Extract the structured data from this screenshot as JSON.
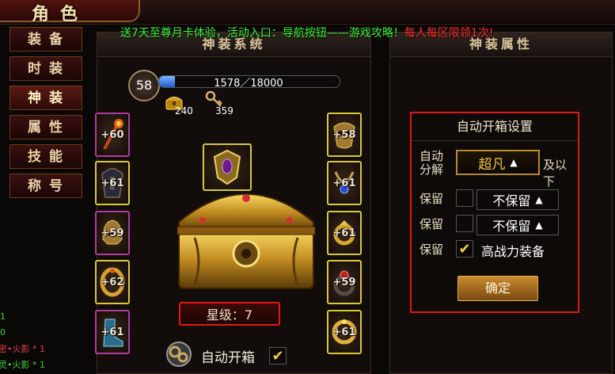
{
  "window": {
    "title": "角色"
  },
  "announcement": {
    "green": "送7天至尊月卡体验，活动入口：导航按钮——游戏攻略！",
    "red": "每人每区限领1次!"
  },
  "menu": [
    {
      "label": "装备",
      "active": false
    },
    {
      "label": "时装",
      "active": false
    },
    {
      "label": "神装",
      "active": true
    },
    {
      "label": "属性",
      "active": false
    },
    {
      "label": "技能",
      "active": false
    },
    {
      "label": "称号",
      "active": false
    }
  ],
  "left_panel": {
    "title": "神装系统",
    "level": "58",
    "xp_text": "1578／18000",
    "xp_fraction": 0.088,
    "resources": [
      {
        "icon": "gold-chest-icon",
        "count": "240"
      },
      {
        "icon": "key-icon",
        "count": "359"
      }
    ],
    "left_slots": [
      {
        "plus": "+60",
        "border": "purple",
        "icon": "flame-staff-icon"
      },
      {
        "plus": "+61",
        "border": "yellow",
        "icon": "dark-armor-icon"
      },
      {
        "plus": "+59",
        "border": "purple",
        "icon": "gold-helm-icon"
      },
      {
        "plus": "+62",
        "border": "yellow",
        "icon": "gold-bracer-icon"
      },
      {
        "plus": "+61",
        "border": "purple",
        "icon": "crystal-boots-icon"
      }
    ],
    "right_slots": [
      {
        "plus": "+58",
        "border": "yellow",
        "icon": "gold-mask-icon"
      },
      {
        "plus": "+61",
        "border": "yellow",
        "icon": "sapphire-necklace-icon"
      },
      {
        "plus": "+61",
        "border": "yellow",
        "icon": "gold-ring-icon"
      },
      {
        "plus": "+59",
        "border": "yellow",
        "icon": "ruby-ring-icon"
      },
      {
        "plus": "+61",
        "border": "yellow",
        "icon": "gold-bangle-icon"
      }
    ],
    "center_slot": {
      "icon": "ornate-shield-icon",
      "border": "yellow"
    },
    "star_level": "星级：7",
    "auto_open_label": "自动开箱",
    "auto_open_checked": true
  },
  "right_panel": {
    "title": "神装属性",
    "dialog": {
      "title": "自动开箱设置",
      "decompose_label": "自动分解",
      "decompose_value": "超凡",
      "decompose_suffix": "及以下",
      "rows": [
        {
          "label": "保留",
          "checked": false,
          "value": "不保留"
        },
        {
          "label": "保留",
          "checked": false,
          "value": "不保留"
        },
        {
          "label": "保留",
          "checked": true,
          "value": "高战力装备"
        }
      ],
      "confirm": "确定"
    }
  },
  "log": [
    {
      "prefix": "1",
      "text": ""
    },
    {
      "prefix": "0",
      "text": ""
    },
    {
      "prefix": "",
      "text": "密•火影 * 1"
    },
    {
      "prefix": "",
      "text": "灵•火影 * 1"
    }
  ],
  "colors": {
    "accent_red": "#e01818",
    "gold": "#f6c640",
    "purple_border": "#b03aa0",
    "yellow_border": "#d8c83a",
    "xp_blue": "#1e5ad0"
  }
}
